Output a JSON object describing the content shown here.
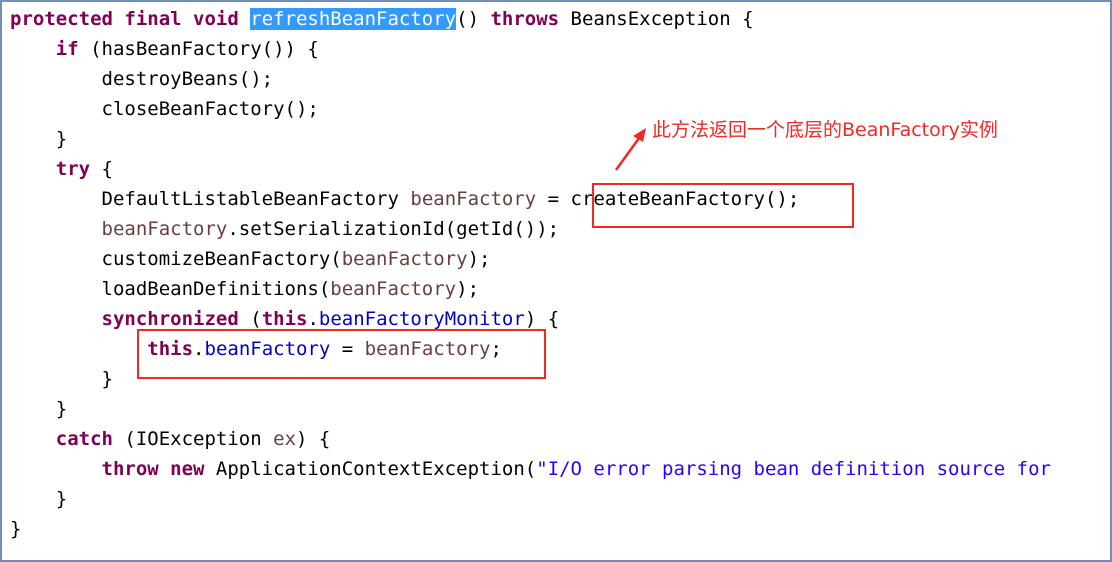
{
  "code_lines": [
    [
      {
        "t": "protected final void ",
        "c": "kw"
      },
      {
        "t": "refreshBeanFactory",
        "c": "sel"
      },
      {
        "t": "() ",
        "c": ""
      },
      {
        "t": "throws",
        "c": "kw"
      },
      {
        "t": " BeansException {",
        "c": ""
      }
    ],
    [
      {
        "t": "    ",
        "c": ""
      },
      {
        "t": "if",
        "c": "kw"
      },
      {
        "t": " (hasBeanFactory()) {",
        "c": ""
      }
    ],
    [
      {
        "t": "        destroyBeans();",
        "c": ""
      }
    ],
    [
      {
        "t": "        closeBeanFactory();",
        "c": ""
      }
    ],
    [
      {
        "t": "    }",
        "c": ""
      }
    ],
    [
      {
        "t": "    ",
        "c": ""
      },
      {
        "t": "try",
        "c": "kw"
      },
      {
        "t": " {",
        "c": ""
      }
    ],
    [
      {
        "t": "        DefaultListableBeanFactory ",
        "c": ""
      },
      {
        "t": "beanFactory",
        "c": "var"
      },
      {
        "t": " = createBeanFactory();",
        "c": ""
      }
    ],
    [
      {
        "t": "        ",
        "c": ""
      },
      {
        "t": "beanFactory",
        "c": "var"
      },
      {
        "t": ".setSerializationId(getId());",
        "c": ""
      }
    ],
    [
      {
        "t": "        customizeBeanFactory(",
        "c": ""
      },
      {
        "t": "beanFactory",
        "c": "var"
      },
      {
        "t": ");",
        "c": ""
      }
    ],
    [
      {
        "t": "        loadBeanDefinitions(",
        "c": ""
      },
      {
        "t": "beanFactory",
        "c": "var"
      },
      {
        "t": ");",
        "c": ""
      }
    ],
    [
      {
        "t": "        ",
        "c": ""
      },
      {
        "t": "synchronized",
        "c": "kw"
      },
      {
        "t": " (",
        "c": ""
      },
      {
        "t": "this",
        "c": "kw"
      },
      {
        "t": ".",
        "c": ""
      },
      {
        "t": "beanFactoryMonitor",
        "c": "fld"
      },
      {
        "t": ") {",
        "c": ""
      }
    ],
    [
      {
        "t": "            ",
        "c": ""
      },
      {
        "t": "this",
        "c": "kw"
      },
      {
        "t": ".",
        "c": ""
      },
      {
        "t": "beanFactory",
        "c": "fld"
      },
      {
        "t": " = ",
        "c": ""
      },
      {
        "t": "beanFactory",
        "c": "var"
      },
      {
        "t": ";",
        "c": ""
      }
    ],
    [
      {
        "t": "        }",
        "c": ""
      }
    ],
    [
      {
        "t": "    }",
        "c": ""
      }
    ],
    [
      {
        "t": "    ",
        "c": ""
      },
      {
        "t": "catch",
        "c": "kw"
      },
      {
        "t": " (IOException ",
        "c": ""
      },
      {
        "t": "ex",
        "c": "var"
      },
      {
        "t": ") {",
        "c": ""
      }
    ],
    [
      {
        "t": "        ",
        "c": ""
      },
      {
        "t": "throw new",
        "c": "kw"
      },
      {
        "t": " ApplicationContextException(",
        "c": ""
      },
      {
        "t": "\"I/O error parsing bean definition source for",
        "c": "str"
      }
    ],
    [
      {
        "t": "    }",
        "c": ""
      }
    ],
    [
      {
        "t": "}",
        "c": ""
      }
    ]
  ],
  "annotation": {
    "text": "此方法返回一个底层的BeanFactory实例"
  },
  "colors": {
    "keyword": "#7f0055",
    "variable": "#6a3e3e",
    "field": "#0000c0",
    "string": "#2a00ff",
    "selection": "#3399ff",
    "annotation": "#ee2a24"
  }
}
